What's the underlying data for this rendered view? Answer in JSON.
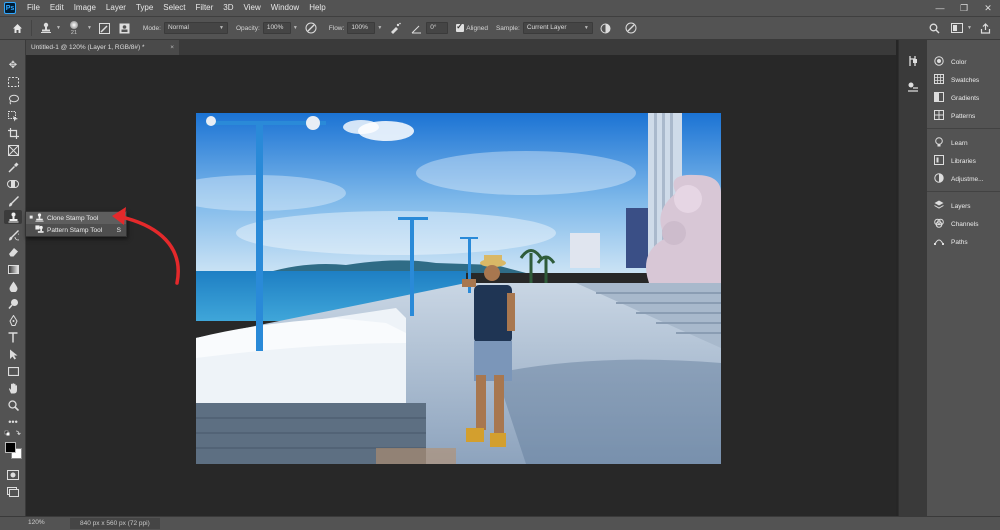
{
  "app": {
    "logo": "Ps"
  },
  "menu": [
    "File",
    "Edit",
    "Image",
    "Layer",
    "Type",
    "Select",
    "Filter",
    "3D",
    "View",
    "Window",
    "Help"
  ],
  "window_controls": {
    "minimize": "—",
    "restore": "❐",
    "close": "✕"
  },
  "options": {
    "brush_size": "21",
    "mode_label": "Mode:",
    "mode_value": "Normal",
    "opacity_label": "Opacity:",
    "opacity_value": "100%",
    "flow_label": "Flow:",
    "flow_value": "100%",
    "angle_value": "0°",
    "aligned_label": "Aligned",
    "sample_label": "Sample:",
    "sample_value": "Current Layer"
  },
  "document": {
    "tab_title": "Untitled-1 @ 120% (Layer 1, RGB/8#) *",
    "close_glyph": "×"
  },
  "flyout": [
    {
      "label": "Clone Stamp Tool",
      "key": "S",
      "selected": true
    },
    {
      "label": "Pattern Stamp Tool",
      "key": "S",
      "selected": false
    }
  ],
  "right_panel": {
    "group1": [
      "Color",
      "Swatches",
      "Gradients",
      "Patterns"
    ],
    "group2": [
      "Learn",
      "Libraries",
      "Adjustme..."
    ],
    "group3": [
      "Layers",
      "Channels",
      "Paths"
    ]
  },
  "status": {
    "zoom": "120%",
    "doc_info": "840 px x 560 px (72 ppi)"
  },
  "colors": {
    "accent_arrow": "#e4292b",
    "panel": "#535353",
    "canvas": "#282828",
    "ps_blue": "#31a8ff"
  }
}
